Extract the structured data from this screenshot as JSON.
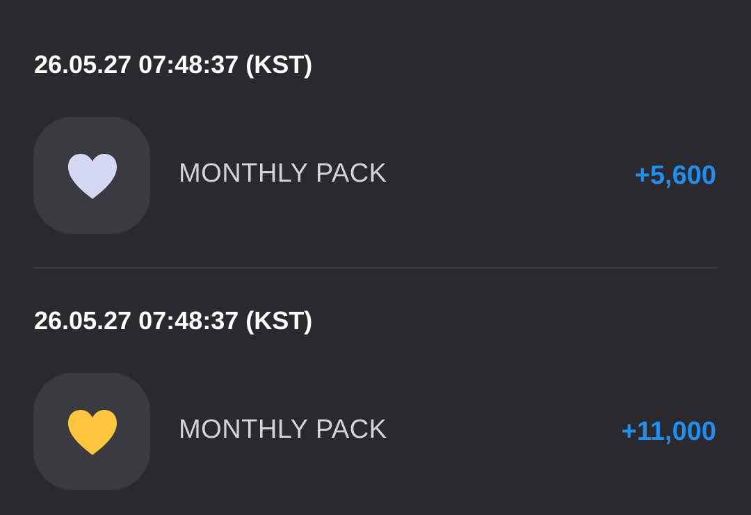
{
  "colors": {
    "background": "#2a292e",
    "tile": "#3a3a41",
    "amount": "#1f8ff0",
    "heart_lavender": "#d5d8f3",
    "heart_gold": "#ffc63d"
  },
  "transactions": [
    {
      "timestamp": "26.05.27 07:48:37 (KST)",
      "icon": "heart-icon",
      "icon_color": "#d5d8f3",
      "label": "MONTHLY PACK",
      "amount": "+5,600"
    },
    {
      "timestamp": "26.05.27 07:48:37 (KST)",
      "icon": "heart-icon",
      "icon_color": "#ffc63d",
      "label": "MONTHLY PACK",
      "amount": "+11,000"
    }
  ]
}
